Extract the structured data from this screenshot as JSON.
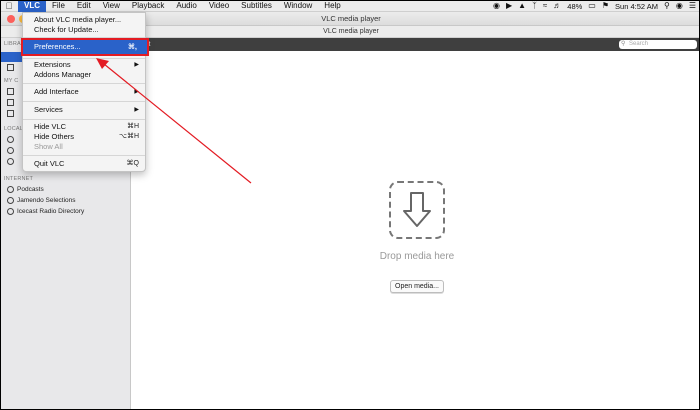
{
  "menubar": {
    "apple": "",
    "items": [
      "VLC",
      "File",
      "Edit",
      "View",
      "Playback",
      "Audio",
      "Video",
      "Subtitles",
      "Window",
      "Help"
    ],
    "tray": {
      "battery": "48%",
      "time": "Sun 4:52 AM"
    }
  },
  "window": {
    "title": "VLC media player",
    "toolbar_title": "VLC media player",
    "playlist_label": "st",
    "search_placeholder": "Search"
  },
  "sidebar": {
    "library_label": "LIBRA",
    "my_computer_label": "MY C",
    "local_label": "LOCAL",
    "internet_label": "INTERNET",
    "internet_items": [
      "Podcasts",
      "Jamendo Selections",
      "Icecast Radio Directory"
    ]
  },
  "main": {
    "drop_text": "Drop media here",
    "open_button": "Open media..."
  },
  "vlc_menu": {
    "about": "About VLC media player...",
    "check_update": "Check for Update...",
    "preferences": "Preferences...",
    "preferences_shortcut": "⌘,",
    "extensions": "Extensions",
    "addons": "Addons Manager",
    "add_interface": "Add Interface",
    "services": "Services",
    "hide_vlc": "Hide VLC",
    "hide_vlc_shortcut": "⌘H",
    "hide_others": "Hide Others",
    "hide_others_shortcut": "⌥⌘H",
    "show_all": "Show All",
    "quit": "Quit VLC",
    "quit_shortcut": "⌘Q"
  },
  "colors": {
    "accent": "#2a62c9",
    "annotation": "#e31b23"
  }
}
